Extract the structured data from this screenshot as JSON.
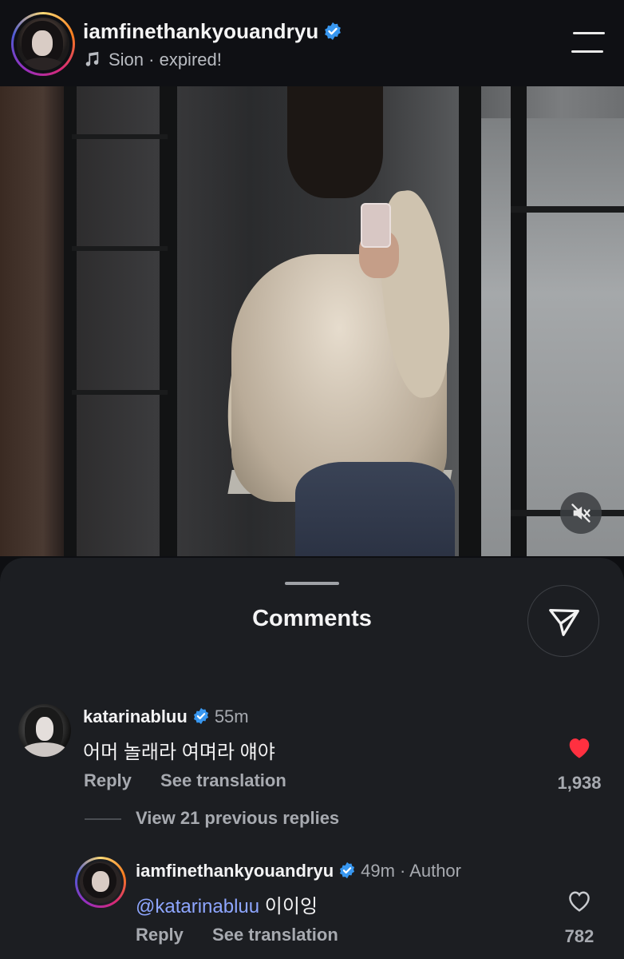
{
  "header": {
    "username": "iamfinethankyouandryu",
    "music_text": "Sion · expired!"
  },
  "sheet": {
    "title": "Comments"
  },
  "comments": [
    {
      "username": "katarinabluu",
      "time": "55m",
      "text": "어머 놀래라 여며라 얘야",
      "reply_label": "Reply",
      "translate_label": "See translation",
      "likes": "1,938",
      "liked": true
    }
  ],
  "view_replies": "View 21 previous replies",
  "reply": {
    "username": "iamfinethankyouandryu",
    "time": "49m",
    "author_tag": "· Author",
    "mention": "@katarinabluu",
    "text": " 이이잉",
    "reply_label": "Reply",
    "translate_label": "See translation",
    "likes": "782",
    "liked": false
  },
  "colors": {
    "verified": "#3897f0",
    "heart": "#ff3040",
    "mention": "#8ea6ff"
  },
  "icons": [
    "verified-icon",
    "music-note-icon",
    "menu-icon",
    "mute-icon",
    "send-icon",
    "heart-icon"
  ]
}
